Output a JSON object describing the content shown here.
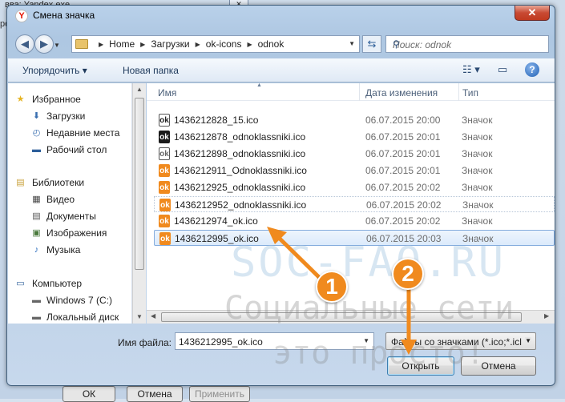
{
  "background": {
    "title": "вва: Yandex.exe",
    "side_text": "ре",
    "buttons": [
      "ОК",
      "Отмена",
      "Применить"
    ]
  },
  "dialog": {
    "title": "Смена значка",
    "close_label": "✕",
    "breadcrumb": [
      "Home",
      "Загрузки",
      "ok-icons",
      "odnok"
    ],
    "search_placeholder": "Поиск: odnok",
    "toolbar": {
      "organize_label": "Упорядочить ▾",
      "new_folder_label": "Новая папка",
      "help_label": "?"
    },
    "sidebar": {
      "items": [
        {
          "label": "Избранное",
          "icon": "star-icon"
        },
        {
          "label": "Загрузки",
          "icon": "downloads-icon"
        },
        {
          "label": "Недавние места",
          "icon": "recent-places-icon"
        },
        {
          "label": "Рабочий стол",
          "icon": "desktop-icon"
        },
        {
          "label": "Библиотеки",
          "icon": "libraries-icon"
        },
        {
          "label": "Видео",
          "icon": "video-icon"
        },
        {
          "label": "Документы",
          "icon": "documents-icon"
        },
        {
          "label": "Изображения",
          "icon": "pictures-icon"
        },
        {
          "label": "Музыка",
          "icon": "music-icon"
        },
        {
          "label": "Компьютер",
          "icon": "computer-icon"
        },
        {
          "label": "Windows 7 (C:)",
          "icon": "drive-icon"
        },
        {
          "label": "Локальный диск",
          "icon": "drive-icon"
        }
      ]
    },
    "columns": {
      "name": "Имя",
      "date": "Дата изменения",
      "type": "Тип"
    },
    "files": [
      {
        "name": "1436212828_15.ico",
        "date": "06.07.2015 20:00",
        "type": "Значок",
        "icon_color": "#ffffff",
        "glyph_color": "#222222"
      },
      {
        "name": "1436212878_odnoklassniki.ico",
        "date": "06.07.2015 20:01",
        "type": "Значок",
        "icon_color": "#1a1a1a",
        "glyph_color": "#ffffff"
      },
      {
        "name": "1436212898_odnoklassniki.ico",
        "date": "06.07.2015 20:01",
        "type": "Значок",
        "icon_color": "#ffffff",
        "glyph_color": "#666666"
      },
      {
        "name": "1436212911_Odnoklassniki.ico",
        "date": "06.07.2015 20:01",
        "type": "Значок",
        "icon_color": "#f08a1e",
        "glyph_color": "#ffffff"
      },
      {
        "name": "1436212925_odnoklassniki.ico",
        "date": "06.07.2015 20:02",
        "type": "Значок",
        "icon_color": "#f08a1e",
        "glyph_color": "#ffffff"
      },
      {
        "name": "1436212952_odnoklassniki.ico",
        "date": "06.07.2015 20:02",
        "type": "Значок",
        "icon_color": "#f08a1e",
        "glyph_color": "#ffffff"
      },
      {
        "name": "1436212974_ok.ico",
        "date": "06.07.2015 20:02",
        "type": "Значок",
        "icon_color": "#f08a1e",
        "glyph_color": "#ffffff"
      },
      {
        "name": "1436212995_ok.ico",
        "date": "06.07.2015 20:03",
        "type": "Значок",
        "icon_color": "#f08a1e",
        "glyph_color": "#ffffff"
      }
    ],
    "filename_label": "Имя файла:",
    "filename_value": "1436212995_ok.ico",
    "filetype_value": "Файлы со значками (*.ico;*.icl",
    "open_label": "Открыть",
    "cancel_label": "Отмена"
  },
  "watermark": {
    "line1": "SOC-FAQ.RU",
    "line2": "Социальные сети",
    "line3": "это просто!"
  },
  "callouts": [
    "1",
    "2"
  ],
  "colors": {
    "accent": "#f08a1e",
    "selection": "#dbeafb"
  }
}
